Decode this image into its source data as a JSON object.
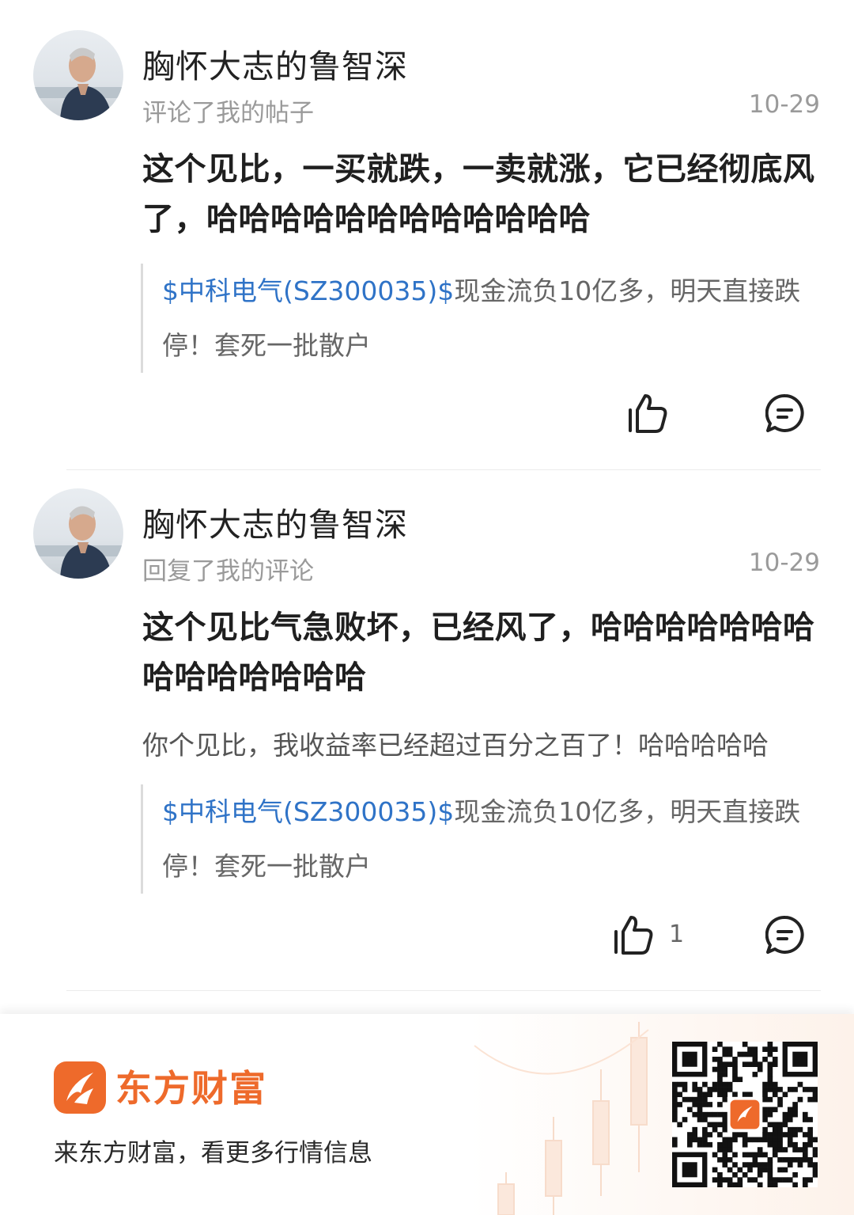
{
  "notifications": [
    {
      "user": "胸怀大志的鲁智深",
      "action": "评论了我的帖子",
      "date": "10-29",
      "reply": "这个见比，一买就跌，一卖就涨，它已经彻底风了，哈哈哈哈哈哈哈哈哈哈哈哈",
      "my_comment": "",
      "quote_stock": "$中科电气(SZ300035)$",
      "quote_text": "现金流负10亿多，明天直接跌停！套死一批散户",
      "like_count": ""
    },
    {
      "user": "胸怀大志的鲁智深",
      "action": "回复了我的评论",
      "date": "10-29",
      "reply": "这个见比气急败坏，已经风了，哈哈哈哈哈哈哈哈哈哈哈哈哈哈",
      "my_comment": "你个见比，我收益率已经超过百分之百了！哈哈哈哈哈",
      "quote_stock": "$中科电气(SZ300035)$",
      "quote_text": "现金流负10亿多，明天直接跌停！套死一批散户",
      "like_count": "1"
    }
  ],
  "footer": {
    "brand": "东方财富",
    "slogan": "来东方财富，看更多行情信息"
  },
  "colors": {
    "link": "#2f73c7",
    "brand": "#ee6a2b",
    "muted": "#9a9a9a"
  },
  "icons": {
    "like": "thumbs-up-icon",
    "comment": "comment-bubble-icon",
    "brand": "eastmoney-logo-icon",
    "qr": "qr-code-icon"
  }
}
